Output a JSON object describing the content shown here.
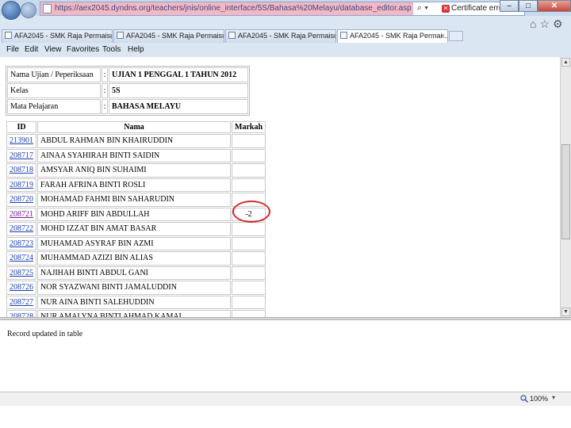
{
  "browser": {
    "url": "https://aex2045.dyndns.org/teachers/jnis/online_interface/5S/Bahasa%20Melayu/database_editor.asp",
    "search_dropdown": "⌕ ▾",
    "certificate_error": "Certificate error",
    "address_tools": "↔ ×",
    "win_min": "–",
    "win_max": "□",
    "win_close": "✕",
    "browser_icons": "⌂☆⚙",
    "tabs": [
      {
        "label": "AFA2045 - SMK Raja Permaisur..."
      },
      {
        "label": "AFA2045 - SMK Raja Permaisur..."
      },
      {
        "label": "AFA2045 - SMK Raja Permaisur..."
      },
      {
        "label": "AFA2045 - SMK Raja Permai..."
      }
    ],
    "tab_close": "×",
    "menu": {
      "file": "File",
      "edit": "Edit",
      "view": "View",
      "favorites": "Favorites",
      "tools": "Tools",
      "help": "Help"
    }
  },
  "info": {
    "sep": ":",
    "exam_label": "Nama Ujian / Peperiksaan",
    "exam_value": "UJIAN 1 PENGGAL 1 TAHUN 2012",
    "class_label": "Kelas",
    "class_value": "5S",
    "subject_label": "Mata Pelajaran",
    "subject_value": "BAHASA MELAYU"
  },
  "table": {
    "headers": {
      "id": "ID",
      "name": "Nama",
      "mark": "Markah"
    },
    "rows": [
      {
        "id": "213901",
        "name": "ABDUL RAHMAN BIN KHAIRUDDIN",
        "mark": ""
      },
      {
        "id": "208717",
        "name": "AINAA SYAHIRAH BINTI SAIDIN",
        "mark": ""
      },
      {
        "id": "208718",
        "name": "AMSYAR ANIQ BIN SUHAIMI",
        "mark": ""
      },
      {
        "id": "208719",
        "name": "FARAH AFRINA BINTI ROSLI",
        "mark": ""
      },
      {
        "id": "208720",
        "name": "MOHAMAD FAHMI BIN SAHARUDIN",
        "mark": ""
      },
      {
        "id": "208721",
        "name": "MOHD ARIFF BIN ABDULLAH",
        "mark": "-2"
      },
      {
        "id": "208722",
        "name": "MOHD IZZAT BIN AMAT BASAR",
        "mark": ""
      },
      {
        "id": "208723",
        "name": "MUHAMAD ASYRAF BIN AZMI",
        "mark": ""
      },
      {
        "id": "208724",
        "name": "MUHAMMAD AZIZI BIN ALIAS",
        "mark": ""
      },
      {
        "id": "208725",
        "name": "NAJIHAH BINTI ABDUL GANI",
        "mark": ""
      },
      {
        "id": "208726",
        "name": "NOR SYAZWANI BINTI JAMALUDDIN",
        "mark": ""
      },
      {
        "id": "208727",
        "name": "NUR AINA BINTI SALEHUDDIN",
        "mark": ""
      },
      {
        "id": "208728",
        "name": "NUR AMALYNA BINTI AHMAD KAMAL",
        "mark": ""
      }
    ]
  },
  "status": {
    "message": "Record updated in table"
  },
  "statusbar": {
    "zoom": "100%",
    "zoom_dropdown": "▾"
  },
  "colors": {
    "highlight_circle": "#d42a2a",
    "link": "#1a3fb0",
    "visited_link": "#7a1c8a",
    "url_highlight": "#f4b7c6"
  }
}
